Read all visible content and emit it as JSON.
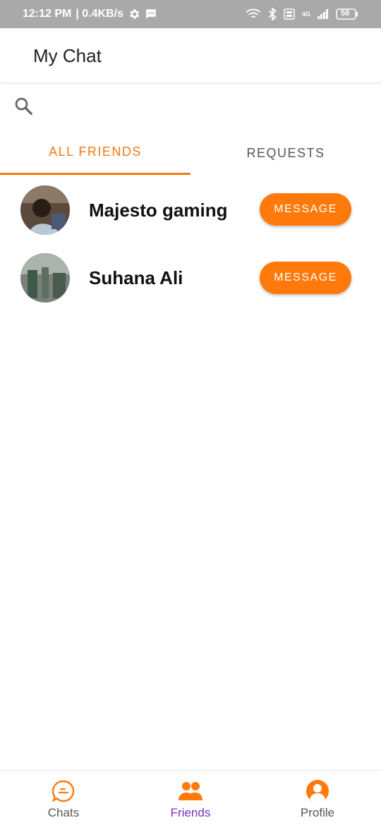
{
  "status_bar": {
    "time": "12:12 PM",
    "speed": "| 0.4KB/s",
    "network": "4G",
    "battery": "58"
  },
  "app_bar": {
    "title": "My Chat"
  },
  "search": {
    "placeholder": ""
  },
  "tabs": [
    {
      "label": "ALL FRIENDS",
      "active": true
    },
    {
      "label": "REQUESTS",
      "active": false
    }
  ],
  "friends": [
    {
      "name": "Majesto gaming",
      "button": "MESSAGE"
    },
    {
      "name": "Suhana Ali",
      "button": "MESSAGE"
    }
  ],
  "bottom_nav": [
    {
      "label": "Chats",
      "icon": "chat-bubble-icon"
    },
    {
      "label": "Friends",
      "icon": "friends-icon",
      "active": true
    },
    {
      "label": "Profile",
      "icon": "profile-icon"
    }
  ],
  "colors": {
    "accent": "#ff7a0a",
    "active_nav_label": "#7b2cbf",
    "status_bar": "#a9a9a9"
  }
}
